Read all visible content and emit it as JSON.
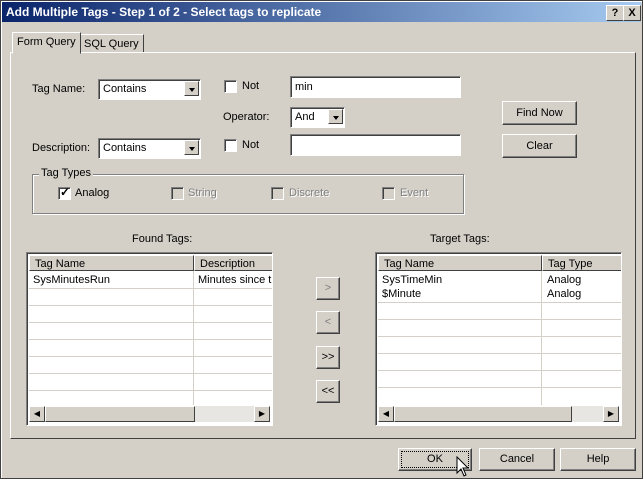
{
  "window": {
    "title": "Add Multiple Tags - Step 1 of 2 - Select tags to replicate",
    "help_btn": "?",
    "close_btn": "X"
  },
  "tabs": [
    {
      "label": "Form Query",
      "active": true
    },
    {
      "label": "SQL Query",
      "active": false
    }
  ],
  "form": {
    "tag_name_label": "Tag Name:",
    "tag_name_match": "Contains",
    "not_label": "Not",
    "tag_name_value": "min",
    "operator_label": "Operator:",
    "operator_value": "And",
    "description_label": "Description:",
    "description_match": "Contains",
    "description_value": "",
    "find_now": "Find Now",
    "clear": "Clear"
  },
  "tag_types": {
    "legend": "Tag Types",
    "items": [
      {
        "label": "Analog",
        "checked": true,
        "enabled": true
      },
      {
        "label": "String",
        "checked": false,
        "enabled": false
      },
      {
        "label": "Discrete",
        "checked": false,
        "enabled": false
      },
      {
        "label": "Event",
        "checked": false,
        "enabled": false
      }
    ]
  },
  "found": {
    "title": "Found Tags:",
    "columns": [
      "Tag Name",
      "Description"
    ],
    "rows": [
      [
        "SysMinutesRun",
        "Minutes since the"
      ]
    ]
  },
  "target": {
    "title": "Target Tags:",
    "columns": [
      "Tag Name",
      "Tag Type"
    ],
    "rows": [
      [
        "SysTimeMin",
        "Analog"
      ],
      [
        "$Minute",
        "Analog"
      ]
    ]
  },
  "move_buttons": {
    "add": ">",
    "remove": "<",
    "add_all": ">>",
    "remove_all": "<<"
  },
  "footer": {
    "ok": "OK",
    "cancel": "Cancel",
    "help": "Help"
  }
}
